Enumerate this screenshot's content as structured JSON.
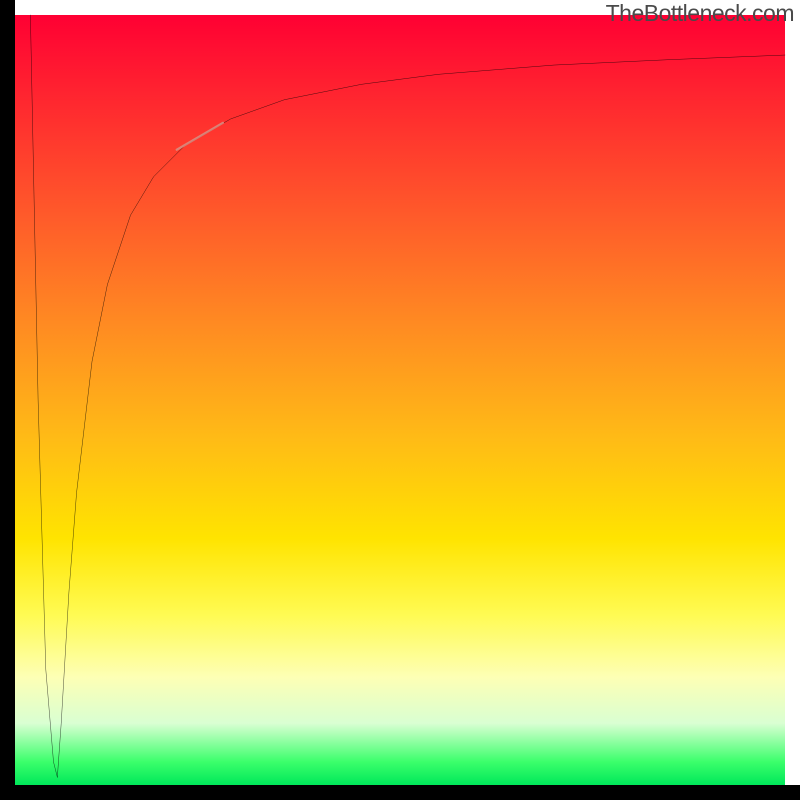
{
  "attribution": "TheBottleneck.com",
  "chart_data": {
    "type": "line",
    "title": "",
    "xlabel": "",
    "ylabel": "",
    "xlim": [
      0,
      100
    ],
    "ylim": [
      0,
      100
    ],
    "grid": false,
    "legend": false,
    "series": [
      {
        "name": "spike",
        "color": "#000000",
        "x": [
          2.0,
          3.0,
          4.0,
          5.0,
          5.5
        ],
        "values": [
          100,
          50,
          15,
          3,
          1
        ]
      },
      {
        "name": "main-curve",
        "color": "#000000",
        "x": [
          5.5,
          6,
          7,
          8,
          10,
          12,
          15,
          18,
          22,
          28,
          35,
          45,
          55,
          70,
          85,
          100
        ],
        "values": [
          1,
          8,
          25,
          38,
          55,
          65,
          74,
          79,
          83,
          86.5,
          89,
          91,
          92.3,
          93.5,
          94.2,
          94.8
        ]
      }
    ],
    "marker": {
      "name": "highlight-segment",
      "color": "#d88f84",
      "opacity": 0.85,
      "x": [
        21,
        27
      ],
      "values": [
        82.5,
        86
      ]
    }
  },
  "colors": {
    "axis": "#000000",
    "curve": "#000000",
    "marker": "#d88f84",
    "gradient_top": "#ff0033",
    "gradient_bottom": "#00e85a"
  }
}
